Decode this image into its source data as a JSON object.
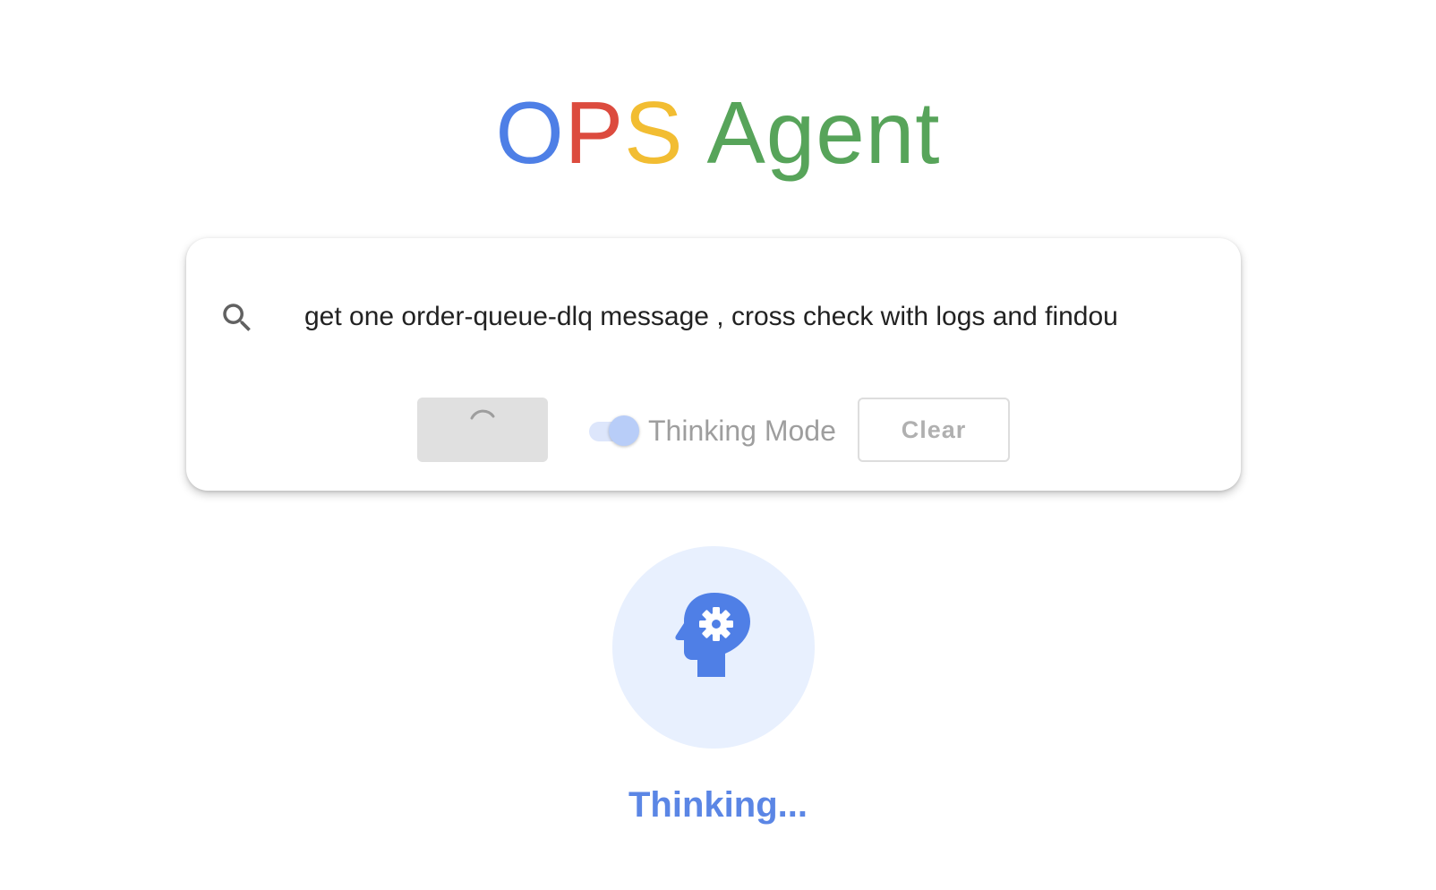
{
  "header": {
    "title_letters": [
      {
        "char": "O",
        "color": "#4e7fe6"
      },
      {
        "char": "P",
        "color": "#dc4b3e"
      },
      {
        "char": "S",
        "color": "#f2bd32"
      },
      {
        "char": "Agent",
        "color": "#57a45a"
      }
    ]
  },
  "search": {
    "icon": "search-icon",
    "value": "get one order-queue-dlq message , cross check with logs and findou"
  },
  "controls": {
    "submit_state": "loading",
    "toggle": {
      "label": "Thinking Mode",
      "checked": true
    },
    "clear_label": "Clear"
  },
  "status": {
    "icon": "psychology-head-gear-icon",
    "label": "Thinking...",
    "accent_color": "#5b86e5",
    "circle_color": "#e8f0fe"
  }
}
